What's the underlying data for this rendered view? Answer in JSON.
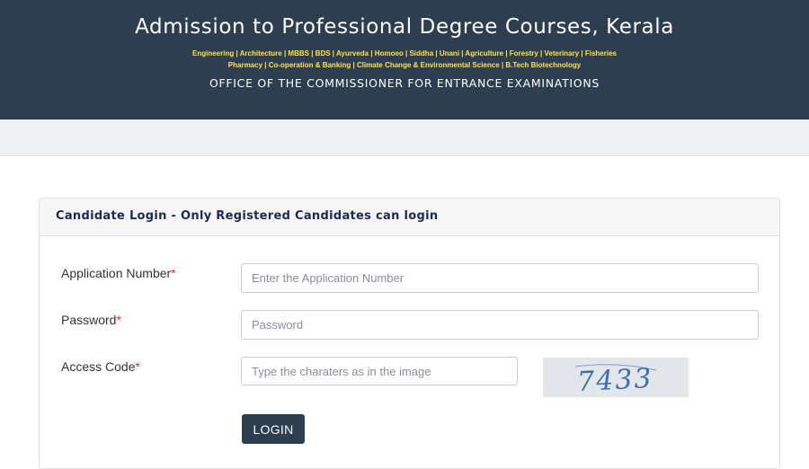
{
  "header": {
    "title": "Admission to Professional Degree Courses, Kerala",
    "courses_line1": "Engineering | Architecture | MBBS | BDS | Ayurveda | Homoeo | Siddha | Unani | Agriculture | Forestry | Veterinary | Fisheries",
    "courses_line2": "Pharmacy | Co-operation & Banking | Climate Change & Environmental Science | B.Tech Biotechnology",
    "office": "OFFICE OF THE COMMISSIONER FOR ENTRANCE EXAMINATIONS"
  },
  "login": {
    "card_title": "Candidate Login - Only Registered Candidates can login",
    "required_mark": "*",
    "application_number": {
      "label": "Application Number",
      "placeholder": "Enter the Application Number"
    },
    "password": {
      "label": "Password",
      "placeholder": "Password"
    },
    "access_code": {
      "label": "Access Code",
      "placeholder": "Type the charaters as in the image"
    },
    "captcha_text": "7433",
    "login_label": "LOGIN"
  },
  "colors": {
    "header_bg": "#2c3e50",
    "courses_text": "#ffe14d",
    "card_title": "#1a2a55",
    "required": "#d9302c",
    "captcha_ink": "#3b6fb0"
  }
}
